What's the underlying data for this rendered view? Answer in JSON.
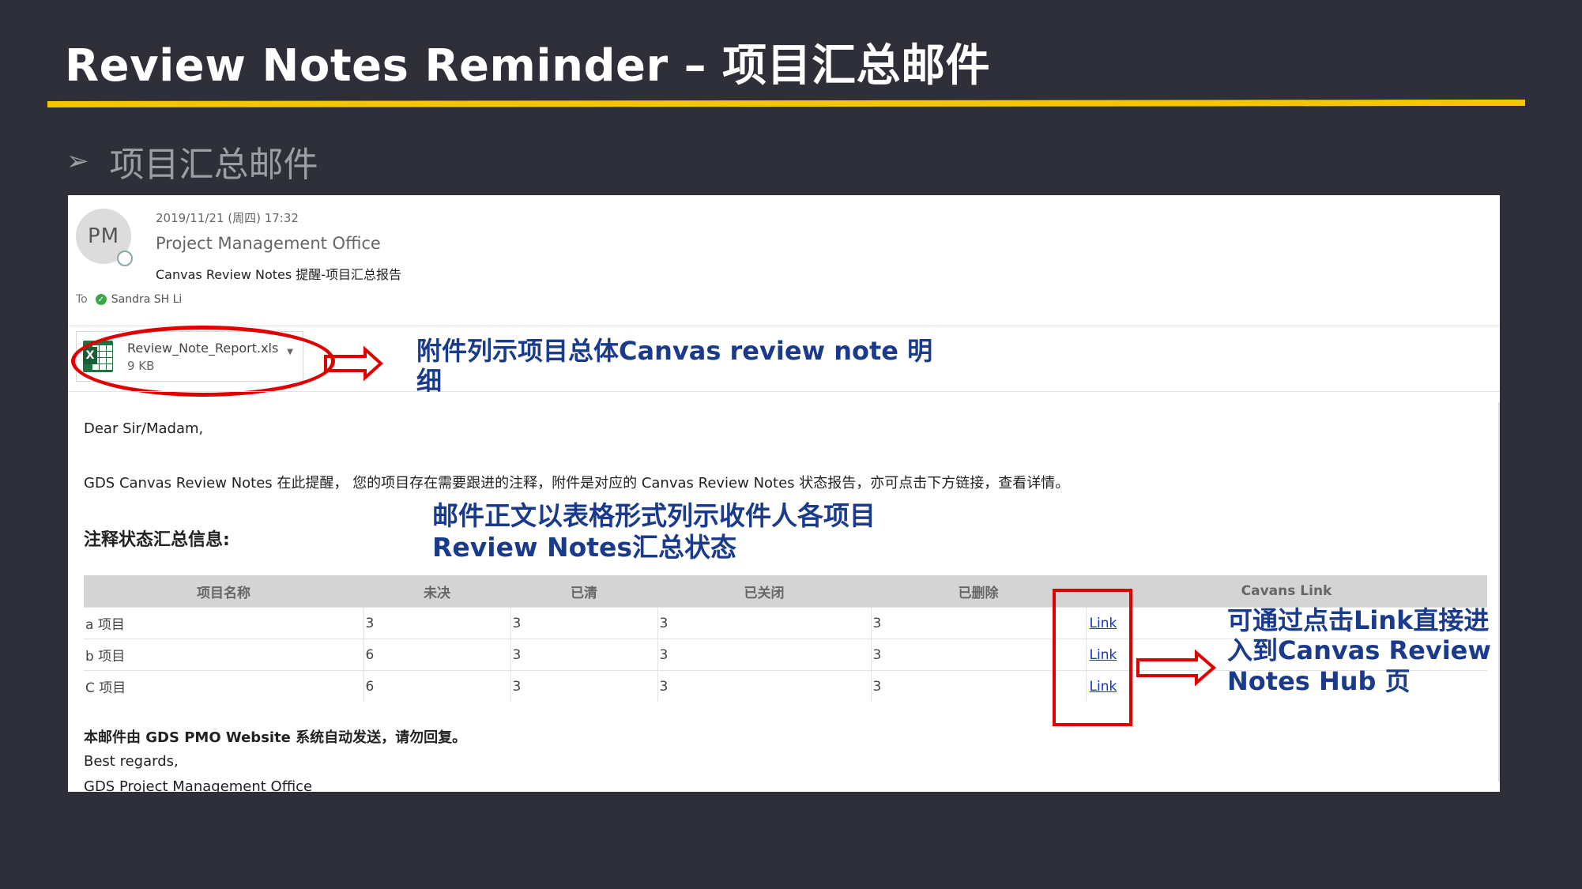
{
  "slide": {
    "title": "Review Notes Reminder – 项目汇总邮件",
    "bullet": "项目汇总邮件"
  },
  "email": {
    "avatar_initials": "PM",
    "date": "2019/11/21 (周四) 17:32",
    "sender": "Project Management Office",
    "subject": "Canvas Review Notes 提醒-项目汇总报告",
    "to_label": "To",
    "recipient": "Sandra SH Li",
    "attachment": {
      "name": "Review_Note_Report.xls",
      "size": "9 KB"
    },
    "greeting": "Dear Sir/Madam,",
    "intro": "GDS Canvas Review Notes 在此提醒， 您的项目存在需要跟进的注释，附件是对应的 Canvas Review Notes 状态报告，亦可点击下方链接，查看详情。",
    "summary_heading": "注释状态汇总信息:",
    "table": {
      "headers": [
        "项目名称",
        "未决",
        "已清",
        "已关闭",
        "已删除",
        "Cavans Link"
      ],
      "rows": [
        [
          "a 项目",
          "3",
          "3",
          "3",
          "3",
          "Link"
        ],
        [
          "b 项目",
          "6",
          "3",
          "3",
          "3",
          "Link"
        ],
        [
          "C 项目",
          "6",
          "3",
          "3",
          "3",
          "Link"
        ]
      ]
    },
    "footer_auto": "本邮件由 GDS PMO Website 系统自动发送，请勿回复。",
    "footer_regards": "Best regards,",
    "footer_org": "GDS Project Management Office"
  },
  "annotations": {
    "attachment_note": "附件列示项目总体Canvas review note 明细",
    "table_note": "邮件正文以表格形式列示收件人各项目Review Notes汇总状态",
    "link_note": "可通过点击Link直接进入到Canvas Review Notes Hub 页",
    "color": "#e00000"
  },
  "colors": {
    "background": "#2e2f38",
    "accent": "#f3c600",
    "annotation_text": "#1a3a8c"
  }
}
